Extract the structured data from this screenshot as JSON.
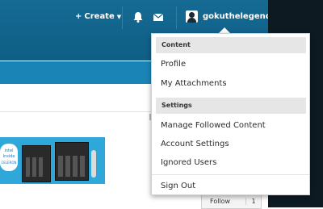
{
  "header": {
    "create_label": "Create",
    "username": "gokuthelegend"
  },
  "dropdown": {
    "content_heading": "Content",
    "content_items": [
      "Profile",
      "My Attachments"
    ],
    "settings_heading": "Settings",
    "settings_items": [
      "Manage Followed Content",
      "Account Settings",
      "Ignored Users"
    ],
    "signout": "Sign Out"
  },
  "banner": {
    "intel_lines": [
      "intel",
      "Inside",
      "CELERON"
    ]
  },
  "follow": {
    "label": "Follow",
    "count": "1"
  }
}
